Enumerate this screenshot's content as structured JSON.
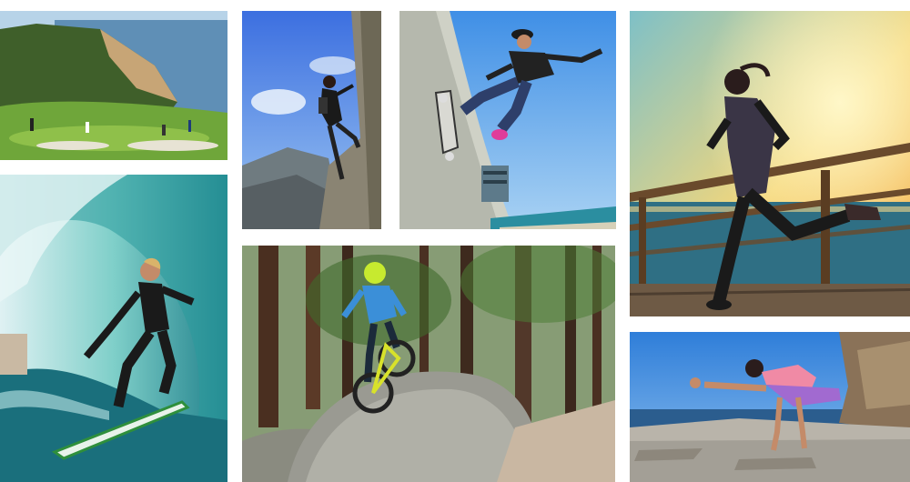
{
  "collage": {
    "tiles": [
      {
        "name": "coastal-golf-course-photo",
        "scene": "golf"
      },
      {
        "name": "rock-climber-photo",
        "scene": "climbing"
      },
      {
        "name": "skateboarder-photo",
        "scene": "skateboard"
      },
      {
        "name": "runner-sunset-pier-photo",
        "scene": "running"
      },
      {
        "name": "surfer-barrel-wave-photo",
        "scene": "surfing"
      },
      {
        "name": "mountain-biker-forest-photo",
        "scene": "mountain-biking"
      },
      {
        "name": "yoga-on-rocks-photo",
        "scene": "yoga"
      }
    ]
  },
  "colors": {
    "background": "#ffffff",
    "sky_blue": "#4a9fe8",
    "sunset_orange": "#f2a23a",
    "ocean_teal": "#2a9a9c",
    "forest_green": "#3f6b2c"
  }
}
